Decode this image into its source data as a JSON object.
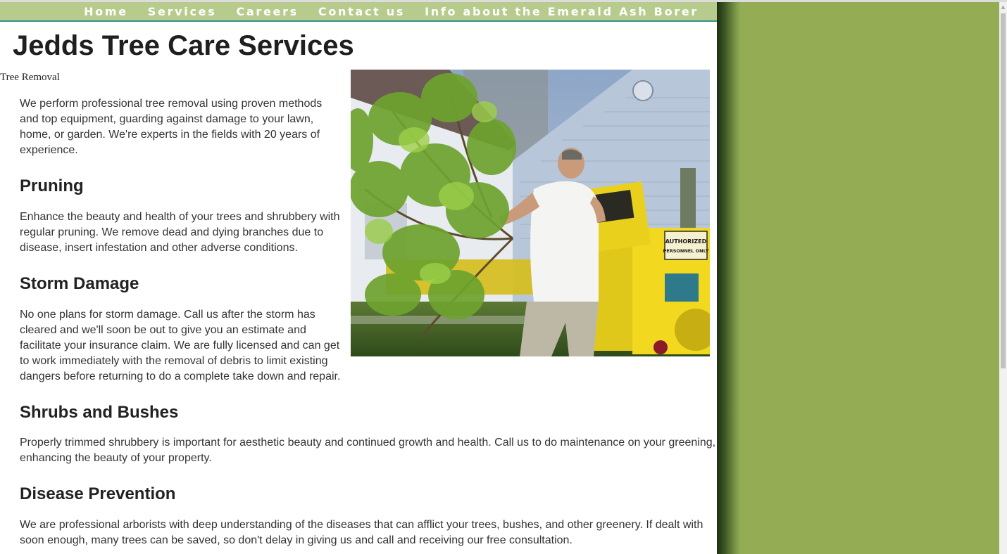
{
  "nav": {
    "items": [
      "Home",
      "Services",
      "Careers",
      "Contact us",
      "Info about the Emerald Ash Borer"
    ]
  },
  "page_title": "Jedds Tree Care Services",
  "sections": [
    {
      "heading": "Tree Removal",
      "body": "We perform professional tree removal using proven methods and top equipment, guarding against damage to your lawn, home, or garden. We're experts in the fields with 20 years of experience."
    },
    {
      "heading": "Pruning",
      "body": "Enhance the beauty and health of your trees and shrubbery with regular pruning. We remove dead and dying branches due to disease, insert infestation and other adverse conditions."
    },
    {
      "heading": "Storm Damage",
      "body": "No one plans for storm damage. Call us after the storm has cleared and we'll soon be out to give you an estimate and facilitate your insurance claim. We are fully licensed and can get to work immediately with the removal of debris to limit existing dangers before returning to do a complete take down and repair."
    },
    {
      "heading": "Shrubs and Bushes",
      "body": "Properly trimmed shrubbery is important for aesthetic beauty and continued growth and health. Call us to do maintenance on your greening, enhancing the beauty of your property."
    },
    {
      "heading": "Disease Prevention",
      "body": "We are professional arborists with deep understanding of the diseases that can afflict your trees, bushes, and other greenery. If dealt with soon enough, many trees can be saved, so don't delay in giving us and call and receiving our free consultation."
    }
  ],
  "photo": {
    "sign_line1": "AUTHORIZED",
    "sign_line2": "PERSONNEL ONLY"
  },
  "colors": {
    "nav_bg": "#b6cb8c",
    "nav_border": "#3a8e8c",
    "page_bg_outside": "#94ad55",
    "content_bg": "#ffffff"
  }
}
